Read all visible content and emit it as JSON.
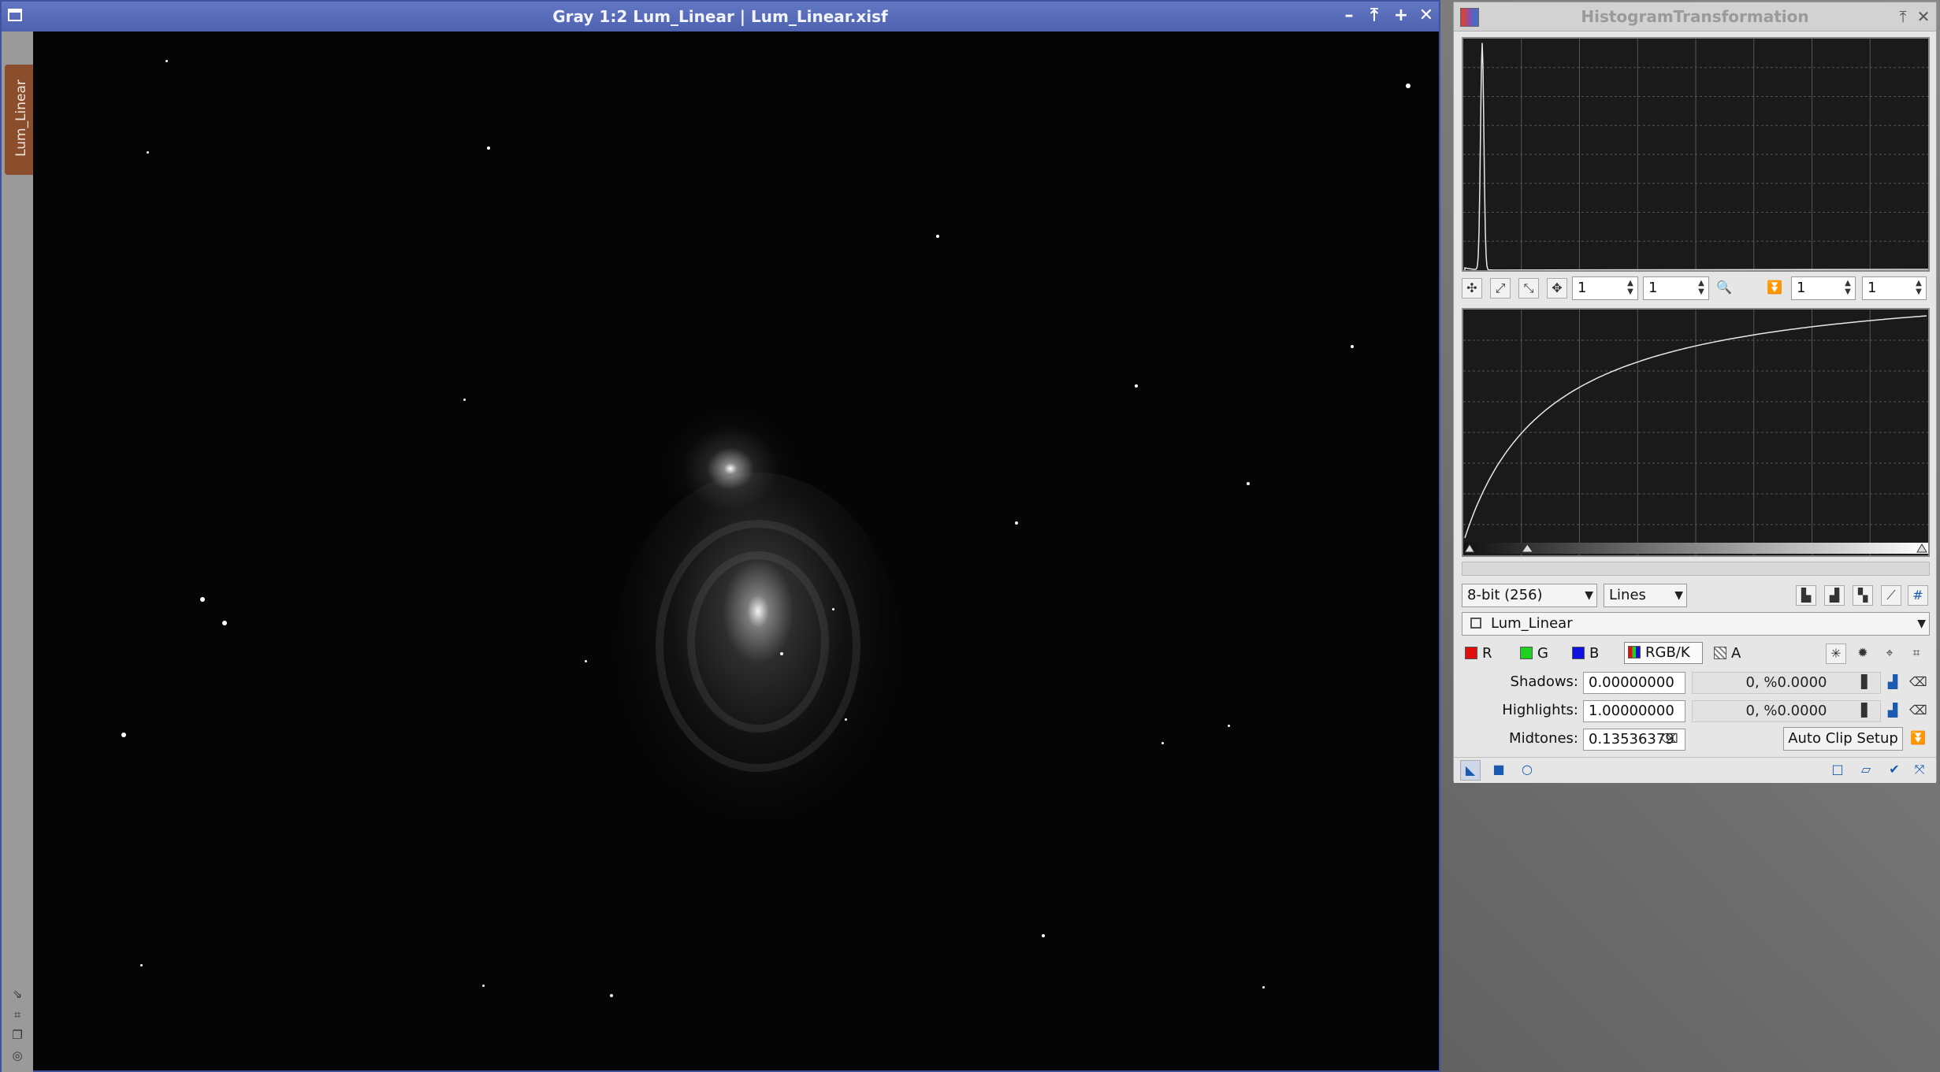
{
  "image_window": {
    "title": "Gray 1:2 Lum_Linear | Lum_Linear.xisf",
    "vertical_tab": "Lum_Linear",
    "buttons": [
      "minimize",
      "shade",
      "maximize",
      "close"
    ]
  },
  "histogram_panel": {
    "title": "HistogramTransformation",
    "zoom_h": "1",
    "zoom_v": "1",
    "out_zoom_h": "1",
    "out_zoom_v": "1",
    "resolution": "8-bit (256)",
    "plot_style": "Lines",
    "view": "Lum_Linear",
    "channels": {
      "r": "R",
      "g": "G",
      "b": "B",
      "rgbk": "RGB/K",
      "a": "A"
    },
    "shadows_label": "Shadows:",
    "shadows_value": "0.00000000",
    "shadows_clip": "0, %0.0000",
    "highlights_label": "Highlights:",
    "highlights_value": "1.00000000",
    "highlights_clip": "0, %0.0000",
    "midtones_label": "Midtones:",
    "midtones_value": "0.13536379",
    "auto_clip_label": "Auto Clip Setup"
  },
  "colors": {
    "title_bar": "#4d62b0",
    "vertical_tab": "#8a4e2c",
    "accent_blue": "#1a5bb0"
  }
}
